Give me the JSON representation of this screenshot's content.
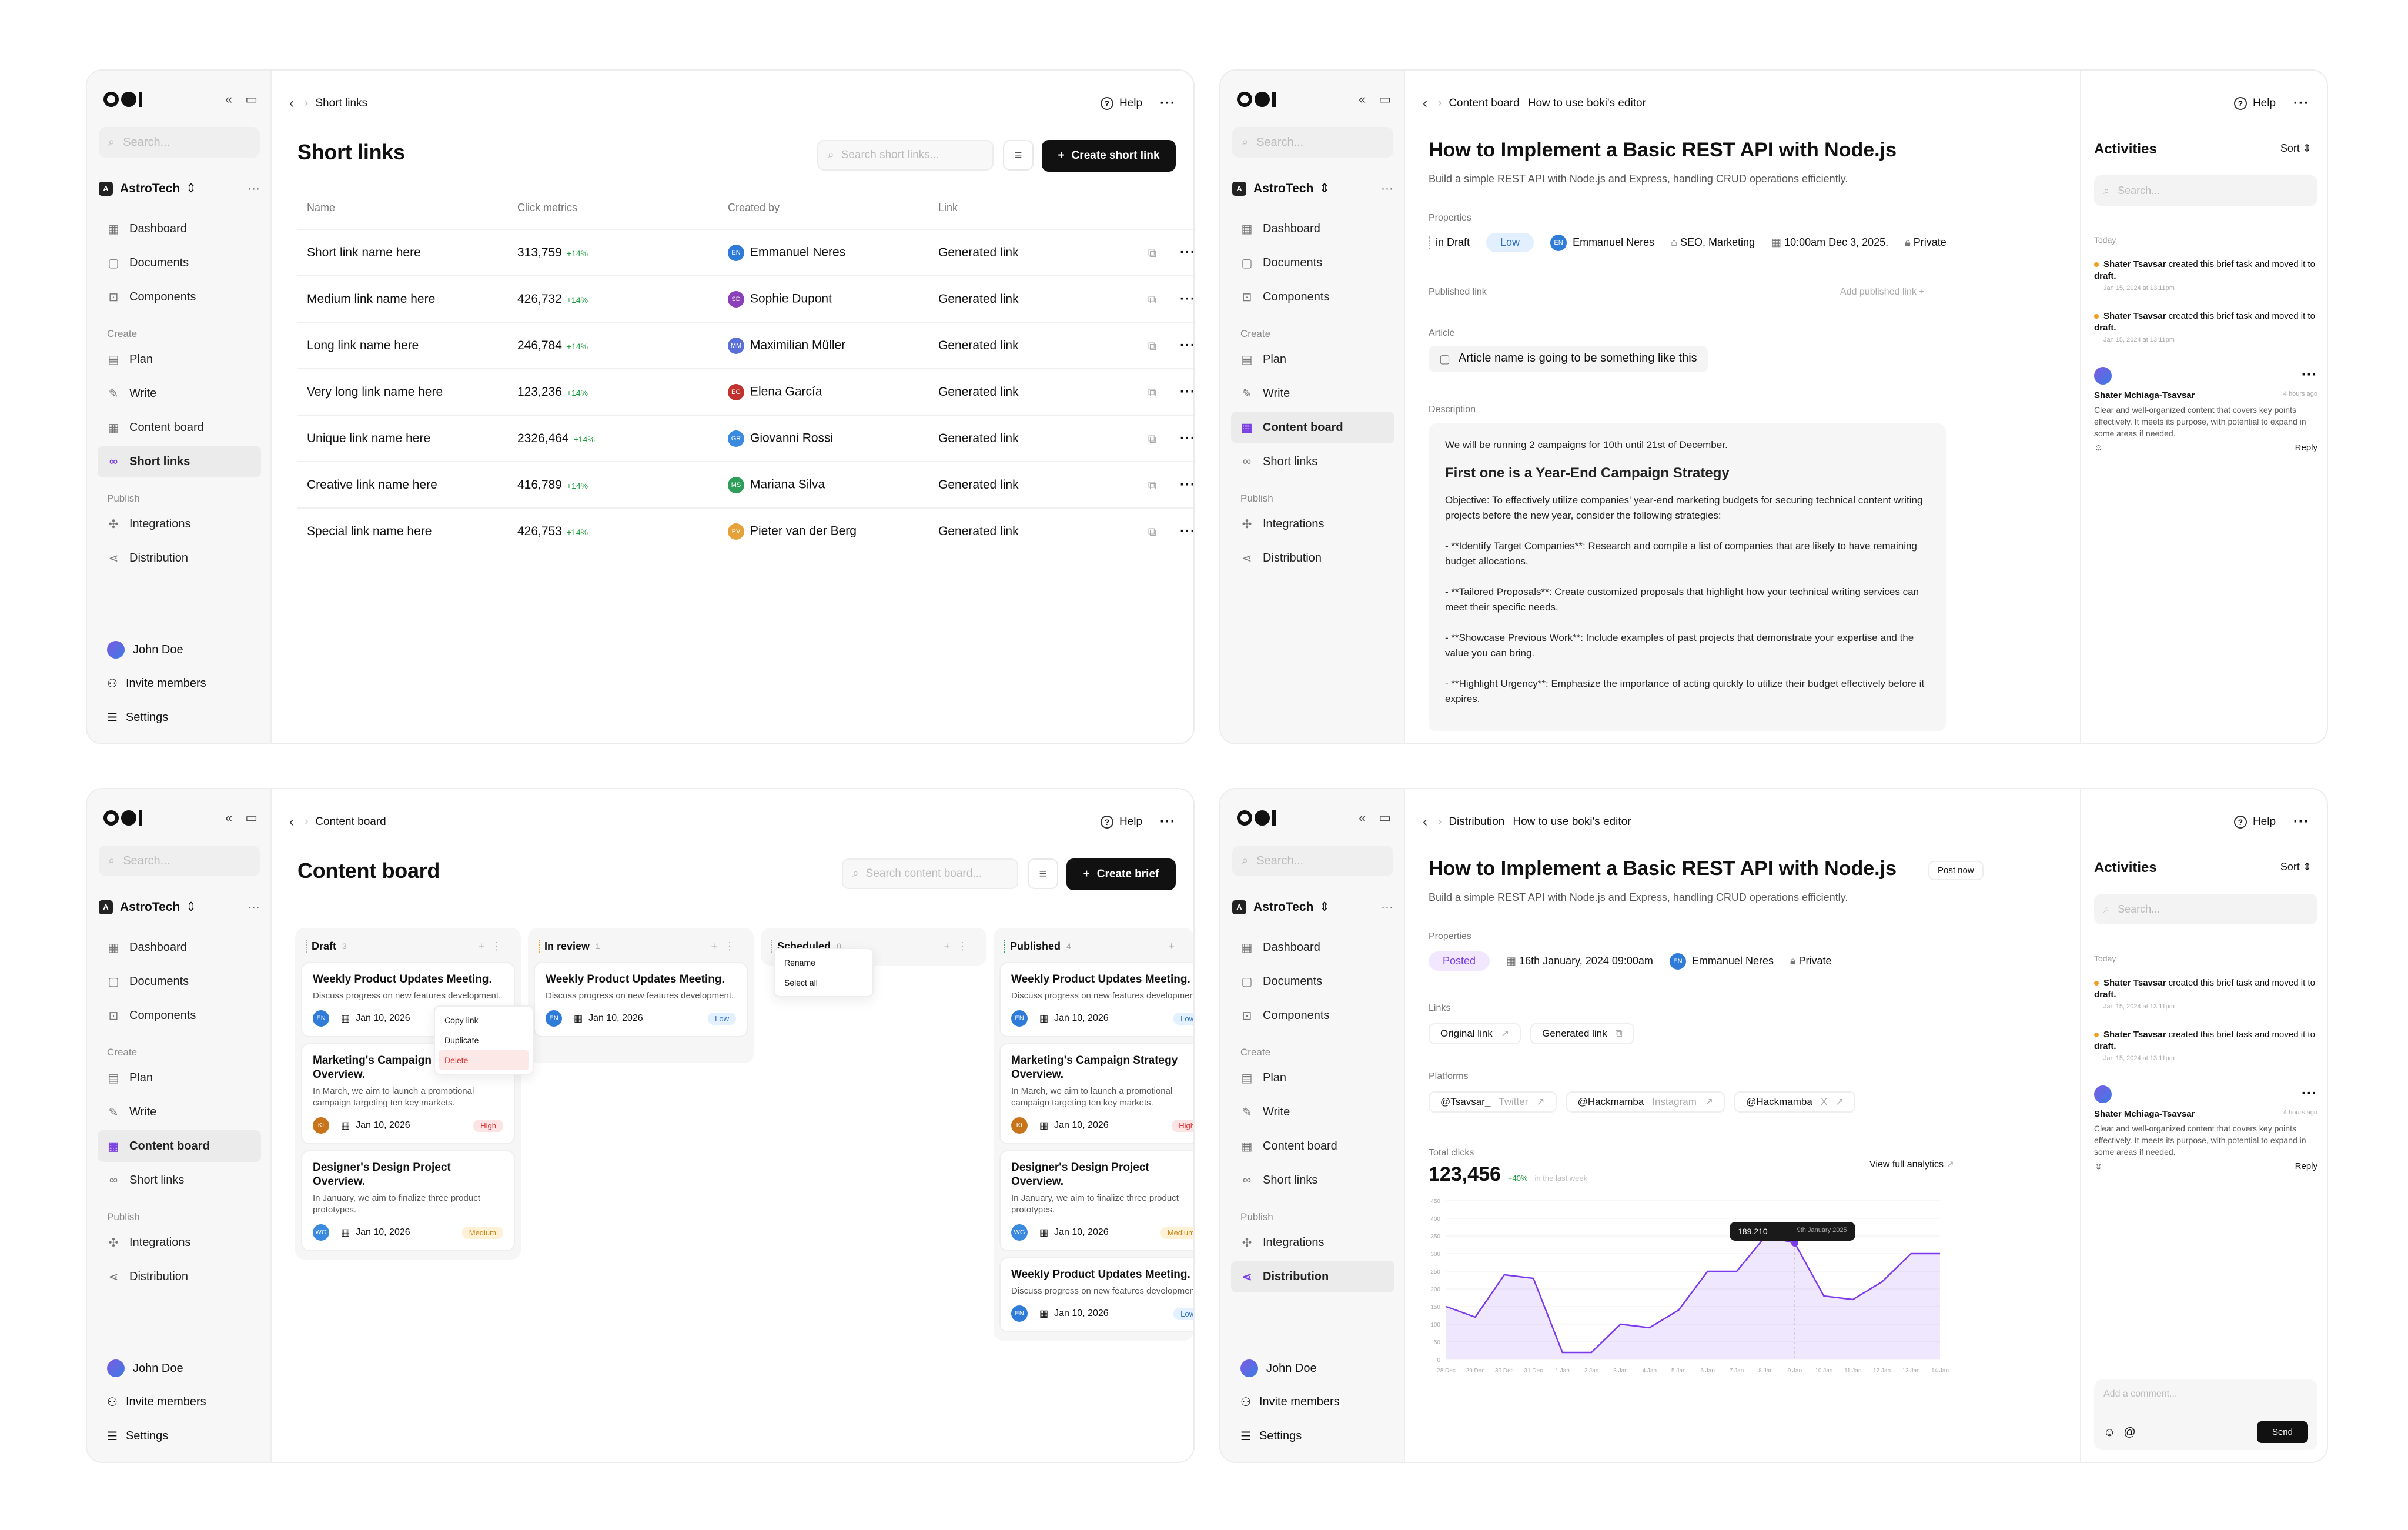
{
  "sidebar": {
    "search_placeholder": "Search...",
    "workspace": "AstroTech",
    "nav_top": [
      "Dashboard",
      "Documents",
      "Components"
    ],
    "create_label": "Create",
    "create_items": [
      "Plan",
      "Write",
      "Content board",
      "Short links"
    ],
    "publish_label": "Publish",
    "publish_items": [
      "Integrations",
      "Distribution"
    ],
    "user": "John Doe",
    "invite": "Invite members",
    "settings": "Settings"
  },
  "common": {
    "help": "Help"
  },
  "short_links": {
    "breadcrumb": "Short links",
    "title": "Short links",
    "search_placeholder": "Search short links...",
    "create_button": "Create short link",
    "headers": [
      "Name",
      "Click metrics",
      "Created by",
      "Link"
    ],
    "rows": [
      {
        "name": "Short link name here",
        "clicks": "313,759",
        "trend": "+14%",
        "initials": "EN",
        "creator": "Emmanuel Neres",
        "link": "Generated link",
        "color": "#2f7bd8"
      },
      {
        "name": "Medium link name here",
        "clicks": "426,732",
        "trend": "+14%",
        "initials": "SD",
        "creator": "Sophie Dupont",
        "link": "Generated link",
        "color": "#8b3fb8"
      },
      {
        "name": "Long link name here",
        "clicks": "246,784",
        "trend": "+14%",
        "initials": "MM",
        "creator": "Maximilian Müller",
        "link": "Generated link",
        "color": "#5b6fd8"
      },
      {
        "name": "Very long link name here",
        "clicks": "123,236",
        "trend": "+14%",
        "initials": "EG",
        "creator": "Elena García",
        "link": "Generated link",
        "color": "#c2332f"
      },
      {
        "name": "Unique link name here",
        "clicks": "2326,464",
        "trend": "+14%",
        "initials": "GR",
        "creator": "Giovanni Rossi",
        "link": "Generated link",
        "color": "#3a8be0"
      },
      {
        "name": "Creative link name here",
        "clicks": "416,789",
        "trend": "+14%",
        "initials": "MS",
        "creator": "Mariana Silva",
        "link": "Generated link",
        "color": "#2f9e58"
      },
      {
        "name": "Special link name here",
        "clicks": "426,753",
        "trend": "+14%",
        "initials": "PV",
        "creator": "Pieter van der Berg",
        "link": "Generated link",
        "color": "#e6a23a"
      }
    ]
  },
  "editor": {
    "breadcrumb_1": "Content board",
    "breadcrumb_2": "How to use boki's editor",
    "title": "How to Implement a Basic REST API with Node.js",
    "subtitle": "Build a simple REST API with Node.js and Express, handling CRUD operations efficiently.",
    "properties_label": "Properties",
    "status": "in Draft",
    "priority": "Low",
    "owner": "Emmanuel Neres",
    "owner_initials": "EN",
    "tags": "SEO, Marketing",
    "date": "10:00am Dec 3, 2025.",
    "visibility": "Private",
    "published_link_label": "Published link",
    "add_published_link": "Add published link",
    "article_label": "Article",
    "article_name": "Article name is going to be something like this",
    "description_label": "Description",
    "desc_intro": "We will be running 2 campaigns for 10th until 21st of December.",
    "desc_heading": "First one is a Year-End Campaign Strategy",
    "desc_objective": "Objective: To effectively utilize companies' year-end marketing budgets for securing technical content writing projects before the new year, consider the following strategies:",
    "desc_b1": "- **Identify Target Companies**: Research and compile a list of companies that are likely to have remaining budget allocations.",
    "desc_b2": "- **Tailored Proposals**: Create customized proposals that highlight how your technical writing services can meet their specific needs.",
    "desc_b3": "- **Showcase Previous Work**: Include examples of past projects that demonstrate your expertise and the value you can bring.",
    "desc_b4": "- **Highlight Urgency**: Emphasize the importance of acting quickly to utilize their budget effectively before it expires."
  },
  "activities": {
    "title": "Activities",
    "sort": "Sort",
    "search_placeholder": "Search...",
    "today": "Today",
    "items": [
      {
        "user": "Shater Tsavsar",
        "text": "created this brief task and moved it to",
        "target": "draft.",
        "time": "Jan 15, 2024 at 13:11pm"
      },
      {
        "user": "Shater Tsavsar",
        "text": "created this brief task and moved it to",
        "target": "draft.",
        "time": "Jan 15, 2024 at 13:11pm"
      }
    ],
    "comment_user": "Shater Mchiaga-Tsavsar",
    "comment_time": "4 hours ago",
    "comment_text": "Clear and well-organized content that covers key points effectively. It meets its purpose, with potential to expand in some areas if needed.",
    "reply": "Reply",
    "add_comment": "Add a comment...",
    "send": "Send"
  },
  "board": {
    "breadcrumb": "Content board",
    "title": "Content board",
    "search_placeholder": "Search content board...",
    "create_button": "Create brief",
    "columns": [
      {
        "name": "Draft",
        "count": "3"
      },
      {
        "name": "In review",
        "count": "1"
      },
      {
        "name": "Scheduled",
        "count": "0"
      },
      {
        "name": "Published",
        "count": "4"
      }
    ],
    "draft_cards": [
      {
        "title": "Weekly Product Updates Meeting.",
        "desc": "Discuss progress on new features development.",
        "initials": "EN",
        "date": "Jan 10, 2026",
        "tag": "Low"
      },
      {
        "title": "Marketing's Campaign Strategy Overview.",
        "desc": "In March, we aim to launch a promotional campaign targeting ten key markets.",
        "initials": "KI",
        "date": "Jan 10, 2026",
        "tag": "High"
      },
      {
        "title": "Designer's Design Project Overview.",
        "desc": "In January, we aim to finalize three product prototypes.",
        "initials": "WG",
        "date": "Jan 10, 2026",
        "tag": "Medium"
      }
    ],
    "review_cards": [
      {
        "title": "Weekly Product Updates Meeting.",
        "desc": "Discuss progress on new features development.",
        "initials": "EN",
        "date": "Jan 10, 2026",
        "tag": "Low"
      }
    ],
    "published_cards": [
      {
        "title": "Weekly Product Updates Meeting.",
        "desc": "Discuss progress on new features development.",
        "initials": "EN",
        "date": "Jan 10, 2026",
        "tag": "Low"
      },
      {
        "title": "Marketing's Campaign Strategy Overview.",
        "desc": "In March, we aim to launch a promotional campaign targeting ten key markets.",
        "initials": "KI",
        "date": "Jan 10, 2026",
        "tag": "High"
      },
      {
        "title": "Designer's Design Project Overview.",
        "desc": "In January, we aim to finalize three product prototypes.",
        "initials": "WG",
        "date": "Jan 10, 2026",
        "tag": "Medium"
      },
      {
        "title": "Weekly Product Updates Meeting.",
        "desc": "Discuss progress on new features development.",
        "initials": "EN",
        "date": "Jan 10, 2026",
        "tag": "Low"
      }
    ],
    "card_menu": [
      "Copy link",
      "Duplicate",
      "Delete"
    ],
    "column_menu": [
      "Rename",
      "Select all"
    ]
  },
  "distribution": {
    "breadcrumb_1": "Distribution",
    "breadcrumb_2": "How to use boki's editor",
    "post_now": "Post now",
    "status": "Posted",
    "date": "16th January, 2024 09:00am",
    "links_label": "Links",
    "original_link": "Original link",
    "generated_link": "Generated link",
    "platforms_label": "Platforms",
    "platforms": [
      {
        "handle": "@Tsavsar_",
        "network": "Twitter"
      },
      {
        "handle": "@Hackmamba",
        "network": "Instagram"
      },
      {
        "handle": "@Hackmamba",
        "network": "X"
      }
    ],
    "total_clicks_label": "Total clicks",
    "total_clicks": "123,456",
    "total_trend": "+40%",
    "total_period": "in the last week",
    "view_analytics": "View full analytics",
    "tooltip_value": "189,210",
    "tooltip_date": "9th January 2025"
  },
  "chart_data": {
    "type": "area",
    "x": [
      "28 Dec",
      "29 Dec",
      "30 Dec",
      "31 Dec",
      "1 Jan",
      "2 Jan",
      "3 Jan",
      "4 Jan",
      "5 Jan",
      "6 Jan",
      "7 Jan",
      "8 Jan",
      "9 Jan",
      "10 Jan",
      "11 Jan",
      "12 Jan",
      "13 Jan",
      "14 Jan"
    ],
    "y_ticks": [
      "0",
      "50",
      "100",
      "150",
      "200",
      "250",
      "300",
      "350",
      "400",
      "450"
    ],
    "values": [
      150,
      120,
      240,
      230,
      20,
      20,
      100,
      90,
      140,
      250,
      250,
      350,
      330,
      180,
      170,
      220,
      300,
      300
    ],
    "ylim": [
      0,
      450
    ],
    "color": "#7c3aed"
  }
}
